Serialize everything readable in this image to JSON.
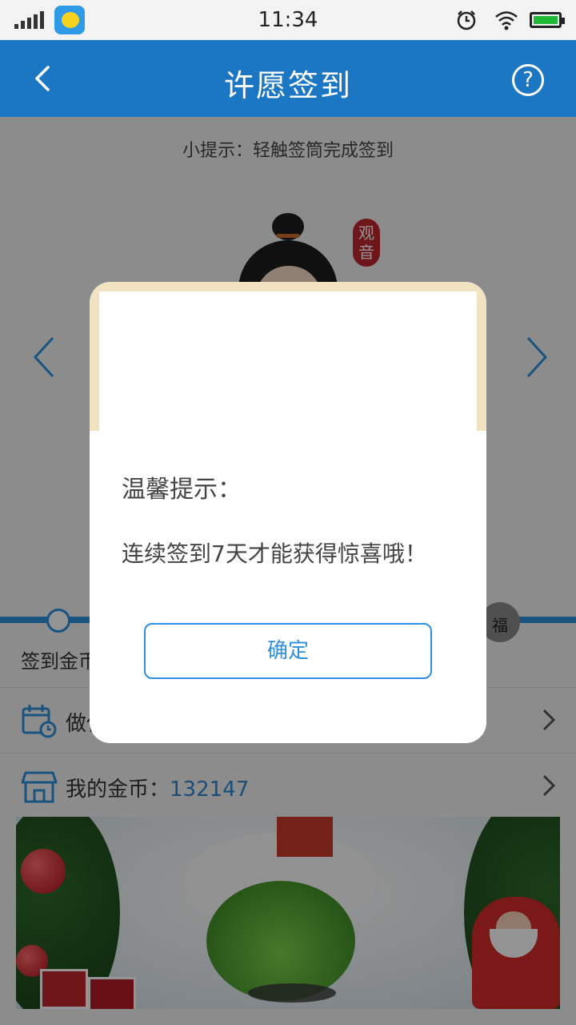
{
  "status_bar": {
    "time": "11:34"
  },
  "header": {
    "title": "许愿签到",
    "help_symbol": "?"
  },
  "hint": "小提示：轻触签筒完成签到",
  "figure": {
    "badge": "观音"
  },
  "progress": {
    "bag_label": "福"
  },
  "coin_row_label": "签到金币",
  "rows": {
    "task_label": "做任务",
    "my_coins_label": "我的金币：",
    "my_coins_value": "132147"
  },
  "dialog": {
    "title": "温馨提示：",
    "message": "连续签到7天才能获得惊喜哦！",
    "ok_label": "确定"
  },
  "colors": {
    "header": "#1b76c4",
    "accent": "#2f8fe0",
    "dialog_frame": "#f1e2c2"
  }
}
